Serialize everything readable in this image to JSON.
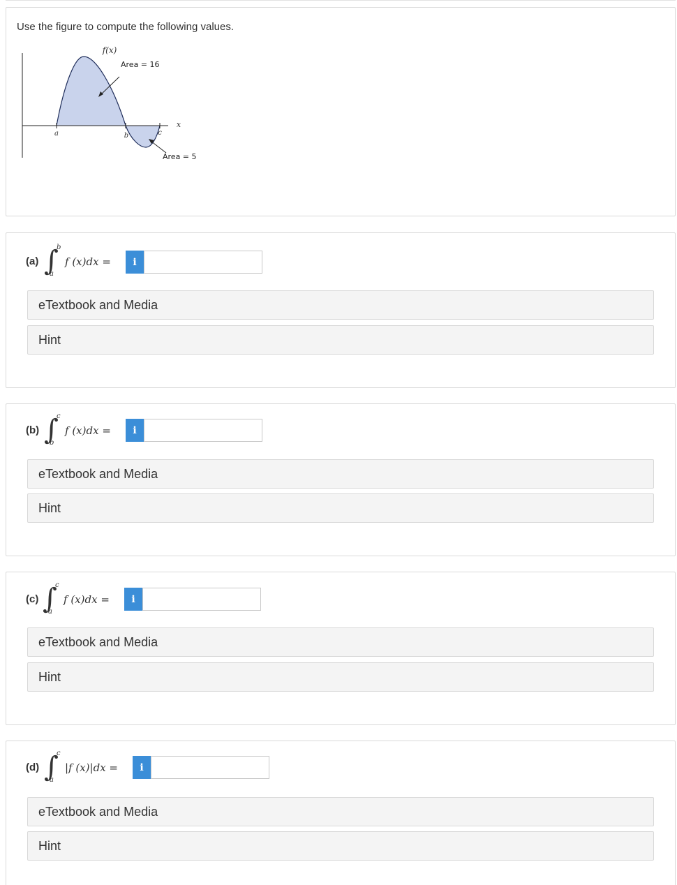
{
  "intro": "Use the figure to compute the following values.",
  "figure": {
    "function_label": "f(x)",
    "area_top_label": "Area = 16",
    "area_bottom_label": "Area = 5",
    "axis_x_label": "x",
    "point_a": "a",
    "point_b": "b",
    "point_c": "c",
    "fill_color": "#c9d3ec"
  },
  "parts": [
    {
      "label": "(a)",
      "upper": "b",
      "lower": "a",
      "integrand": "f (x)dx =",
      "value": "",
      "info": "i",
      "etextbook": "eTextbook and Media",
      "hint": "Hint"
    },
    {
      "label": "(b)",
      "upper": "c",
      "lower": "b",
      "integrand": "f (x)dx =",
      "value": "",
      "info": "i",
      "etextbook": "eTextbook and Media",
      "hint": "Hint"
    },
    {
      "label": "(c)",
      "upper": "c",
      "lower": "a",
      "integrand": "f (x)dx =",
      "value": "",
      "info": "i",
      "etextbook": "eTextbook and Media",
      "hint": "Hint"
    },
    {
      "label": "(d)",
      "upper": "c",
      "lower": "a",
      "integrand": "|f (x)|dx =",
      "value": "",
      "info": "i",
      "etextbook": "eTextbook and Media",
      "hint": "Hint"
    }
  ],
  "colors": {
    "info_button": "#3b8ed8",
    "bar_bg": "#f4f4f4"
  }
}
